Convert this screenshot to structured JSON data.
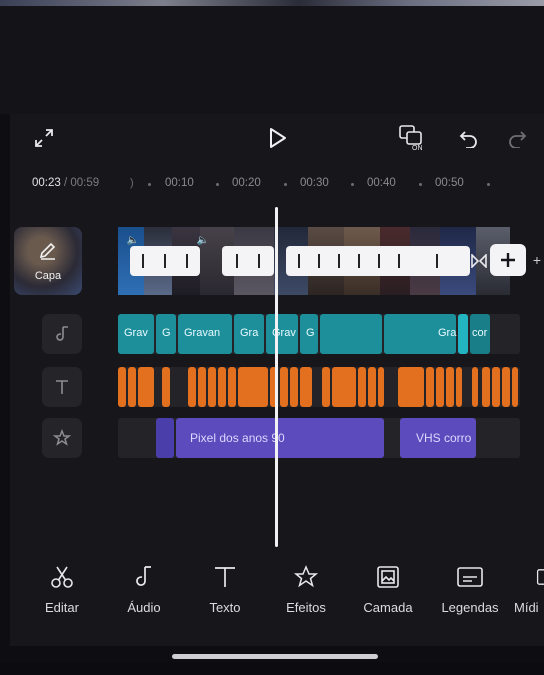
{
  "playback": {
    "current_time": "00:23",
    "separator": "/",
    "total_time": "00:59"
  },
  "ruler": {
    "ticks": [
      "00:10",
      "00:20",
      "00:30",
      "00:40",
      "00:50"
    ]
  },
  "cover": {
    "label": "Capa"
  },
  "tracks": {
    "audio_labels": [
      "Grav",
      "G",
      "Gravan",
      "Gra",
      "Grav",
      "G",
      "Gra",
      "cor"
    ],
    "effect_labels": [
      "Pixel dos anos 90",
      "VHS corro"
    ]
  },
  "toolbar": {
    "items": [
      {
        "label": "Editar",
        "icon": "scissors-icon"
      },
      {
        "label": "Áudio",
        "icon": "music-note-icon"
      },
      {
        "label": "Texto",
        "icon": "text-icon"
      },
      {
        "label": "Efeitos",
        "icon": "sparkle-star-icon"
      },
      {
        "label": "Camada",
        "icon": "image-layer-icon"
      },
      {
        "label": "Legendas",
        "icon": "captions-icon"
      },
      {
        "label": "Mídi",
        "icon": "media-icon"
      }
    ]
  },
  "colors": {
    "audio_track": "#1d8f9a",
    "text_track": "#e2701e",
    "effects_track": "#5b4bbd",
    "background": "#17171b"
  }
}
